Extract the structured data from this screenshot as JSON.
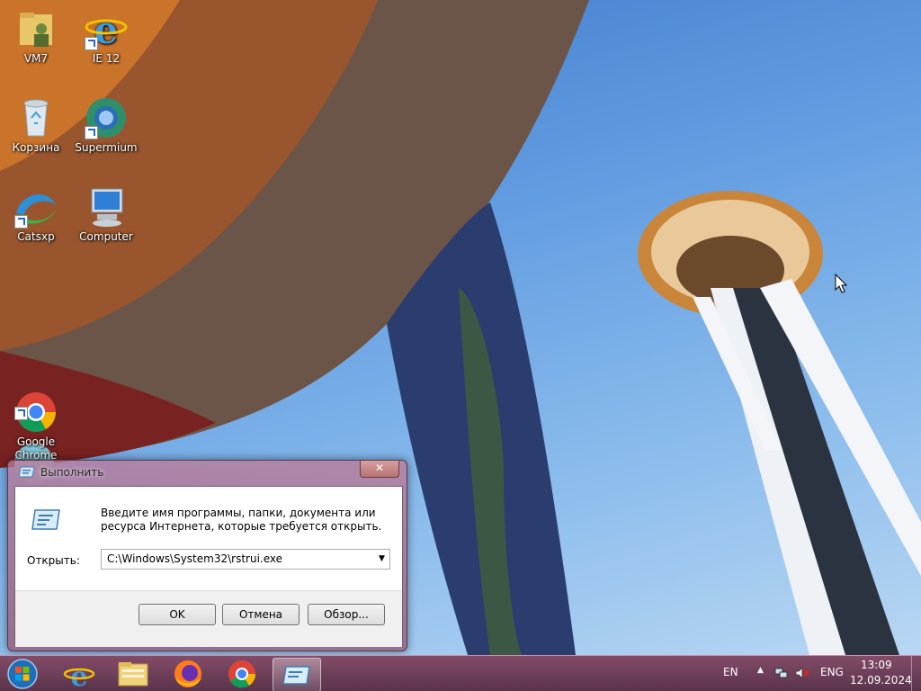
{
  "desktop": {
    "icons": [
      {
        "name": "VM7",
        "icon": "folder-user-icon"
      },
      {
        "name": "IE 12",
        "icon": "internet-explorer-icon"
      },
      {
        "name": "Корзина",
        "icon": "recycle-bin-icon"
      },
      {
        "name": "Supermium",
        "icon": "supermium-icon"
      },
      {
        "name": "Catsxp",
        "icon": "catsxp-icon"
      },
      {
        "name": "Computer",
        "icon": "computer-icon"
      },
      {
        "name": "Google\nChrome",
        "icon": "chrome-icon"
      }
    ]
  },
  "run_dialog": {
    "title": "Выполнить",
    "close_label": "✕",
    "description": "Введите имя программы, папки, документа или ресурса Интернета, которые требуется открыть.",
    "open_label": "Открыть:",
    "open_value": "C:\\Windows\\System32\\rstrui.exe",
    "ok_label": "OK",
    "cancel_label": "Отмена",
    "browse_label": "Обзор..."
  },
  "taskbar": {
    "items": [
      {
        "icon": "internet-explorer-icon"
      },
      {
        "icon": "file-explorer-icon"
      },
      {
        "icon": "firefox-icon"
      },
      {
        "icon": "chrome-icon"
      },
      {
        "icon": "run-dialog-icon",
        "active": true
      }
    ],
    "tray": {
      "lang_short": "EN",
      "lang_long": "ENG",
      "time": "13:09",
      "date": "12.09.2024"
    }
  },
  "colors": {
    "sky": "#5f9ae0",
    "taskbar": "#6a3552"
  }
}
